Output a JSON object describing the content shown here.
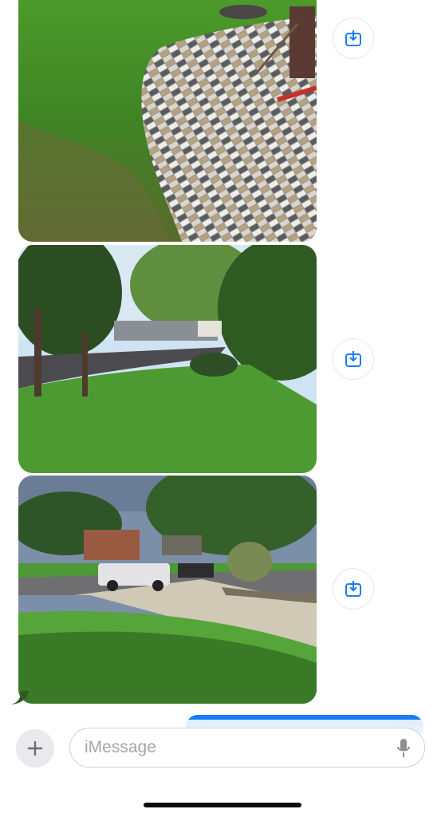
{
  "thread": {
    "photos": [
      {
        "icon": "patio-lawn-photo",
        "save_icon": "save-to-photos-icon"
      },
      {
        "icon": "front-yard-trees-photo",
        "save_icon": "save-to-photos-icon"
      },
      {
        "icon": "yard-street-truck-photo",
        "save_icon": "save-to-photos-icon"
      }
    ]
  },
  "composer": {
    "add_icon": "plus-icon",
    "placeholder": "iMessage",
    "mic_icon": "microphone-icon"
  },
  "colors": {
    "accent": "#1a7cf5",
    "save_icon": "#1a7cf5",
    "bubble_gray": "#e9e9ee",
    "placeholder": "#a5a5aa"
  }
}
